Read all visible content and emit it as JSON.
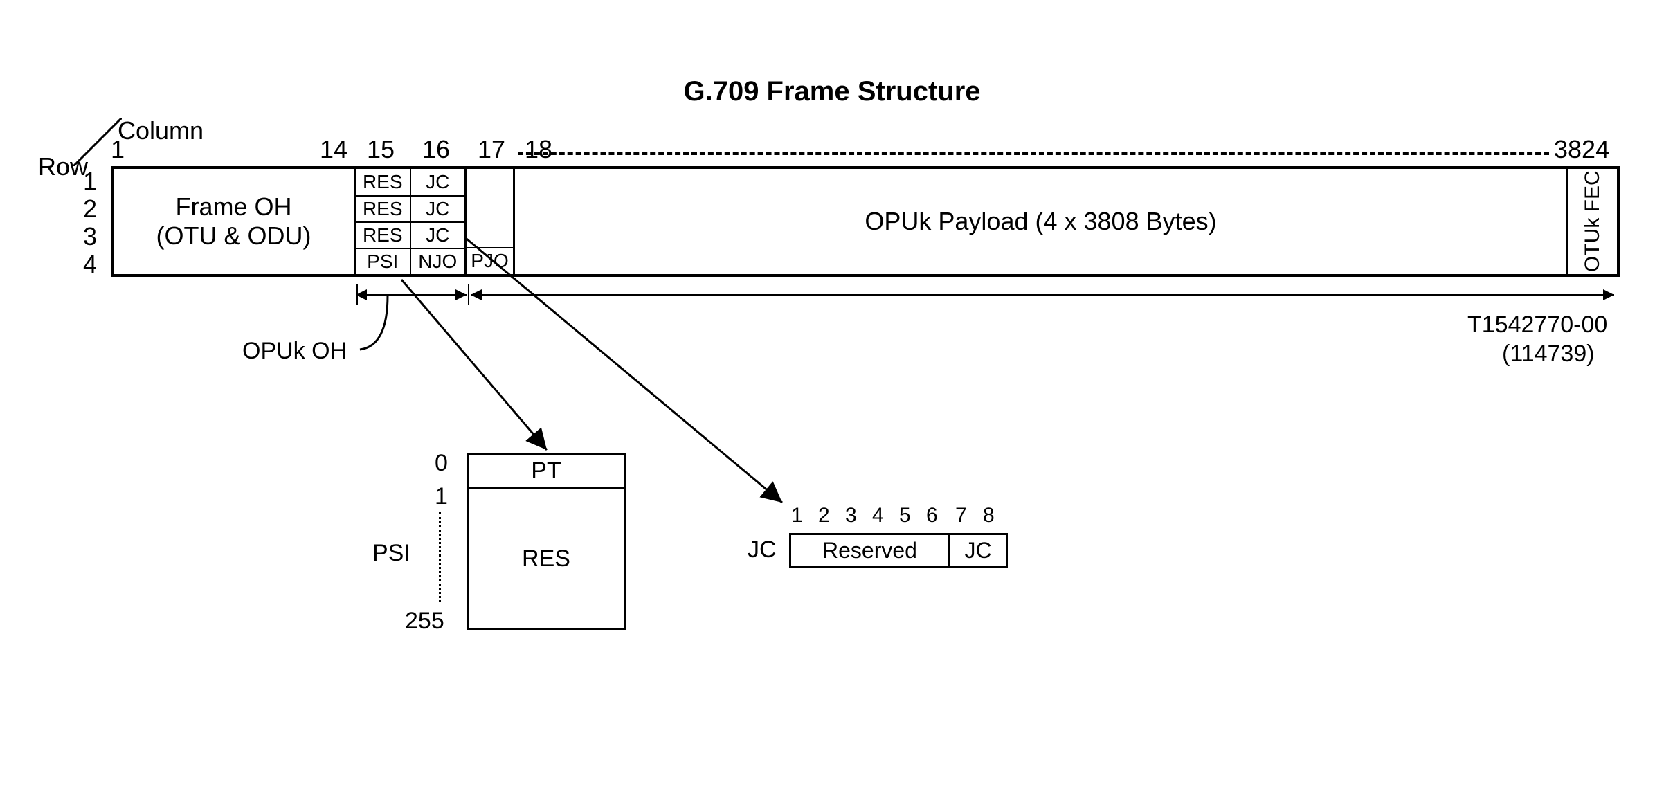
{
  "title": "G.709 Frame Structure",
  "axes": {
    "row": "Row",
    "column": "Column"
  },
  "cols": {
    "c1": "1",
    "c14": "14",
    "c15": "15",
    "c16": "16",
    "c17": "17",
    "c18": "18",
    "c3824": "3824"
  },
  "rows": {
    "r1": "1",
    "r2": "2",
    "r3": "3",
    "r4": "4"
  },
  "frame_oh_l1": "Frame OH",
  "frame_oh_l2": "(OTU & ODU)",
  "grid": {
    "RES": "RES",
    "JC": "JC",
    "PSI": "PSI",
    "NJO": "NJO",
    "PJO": "PJO"
  },
  "payload": "OPUk Payload (4 x 3808 Bytes)",
  "fec": "OTUk FEC",
  "opuk_oh": "OPUk OH",
  "ref1": "T1542770-00",
  "ref2": "(114739)",
  "psi": {
    "label": "PSI",
    "i0": "0",
    "i1": "1",
    "i255": "255",
    "PT": "PT",
    "RES": "RES"
  },
  "jc": {
    "label": "JC",
    "bits": {
      "b1": "1",
      "b2": "2",
      "b3": "3",
      "b4": "4",
      "b5": "5",
      "b6": "6",
      "b7": "7",
      "b8": "8"
    },
    "reserved": "Reserved",
    "jc": "JC"
  },
  "chart_data": {
    "type": "table",
    "title": "G.709 Frame Structure",
    "frame": {
      "rows": 4,
      "columns": 3824,
      "sections": [
        {
          "name": "Frame OH (OTU & ODU)",
          "rows": "1-4",
          "columns": "1-14"
        },
        {
          "name": "OPUk OH",
          "rows": "1-4",
          "columns": "15-16",
          "cells": [
            {
              "row": 1,
              "col": 15,
              "label": "RES"
            },
            {
              "row": 1,
              "col": 16,
              "label": "JC"
            },
            {
              "row": 2,
              "col": 15,
              "label": "RES"
            },
            {
              "row": 2,
              "col": 16,
              "label": "JC"
            },
            {
              "row": 3,
              "col": 15,
              "label": "RES"
            },
            {
              "row": 3,
              "col": 16,
              "label": "JC"
            },
            {
              "row": 4,
              "col": 15,
              "label": "PSI"
            },
            {
              "row": 4,
              "col": 16,
              "label": "NJO"
            }
          ]
        },
        {
          "name": "Column 17",
          "rows": "1-4",
          "columns": "17",
          "cells": [
            {
              "row": 4,
              "col": 17,
              "label": "PJO"
            }
          ]
        },
        {
          "name": "OPUk Payload (4 x 3808 Bytes)",
          "rows": "1-4",
          "columns": "18-3824"
        },
        {
          "name": "OTUk FEC",
          "rows": "1-4",
          "columns": "after 3824"
        }
      ]
    },
    "psi_multiframe": {
      "index_range": [
        0,
        255
      ],
      "entries": [
        {
          "index": 0,
          "label": "PT"
        },
        {
          "index": "1-255",
          "label": "RES"
        }
      ]
    },
    "jc_byte": {
      "bits": 8,
      "fields": [
        {
          "bits": "1-6",
          "label": "Reserved"
        },
        {
          "bits": "7-8",
          "label": "JC"
        }
      ]
    },
    "reference": "T1542770-00 (114739)"
  }
}
